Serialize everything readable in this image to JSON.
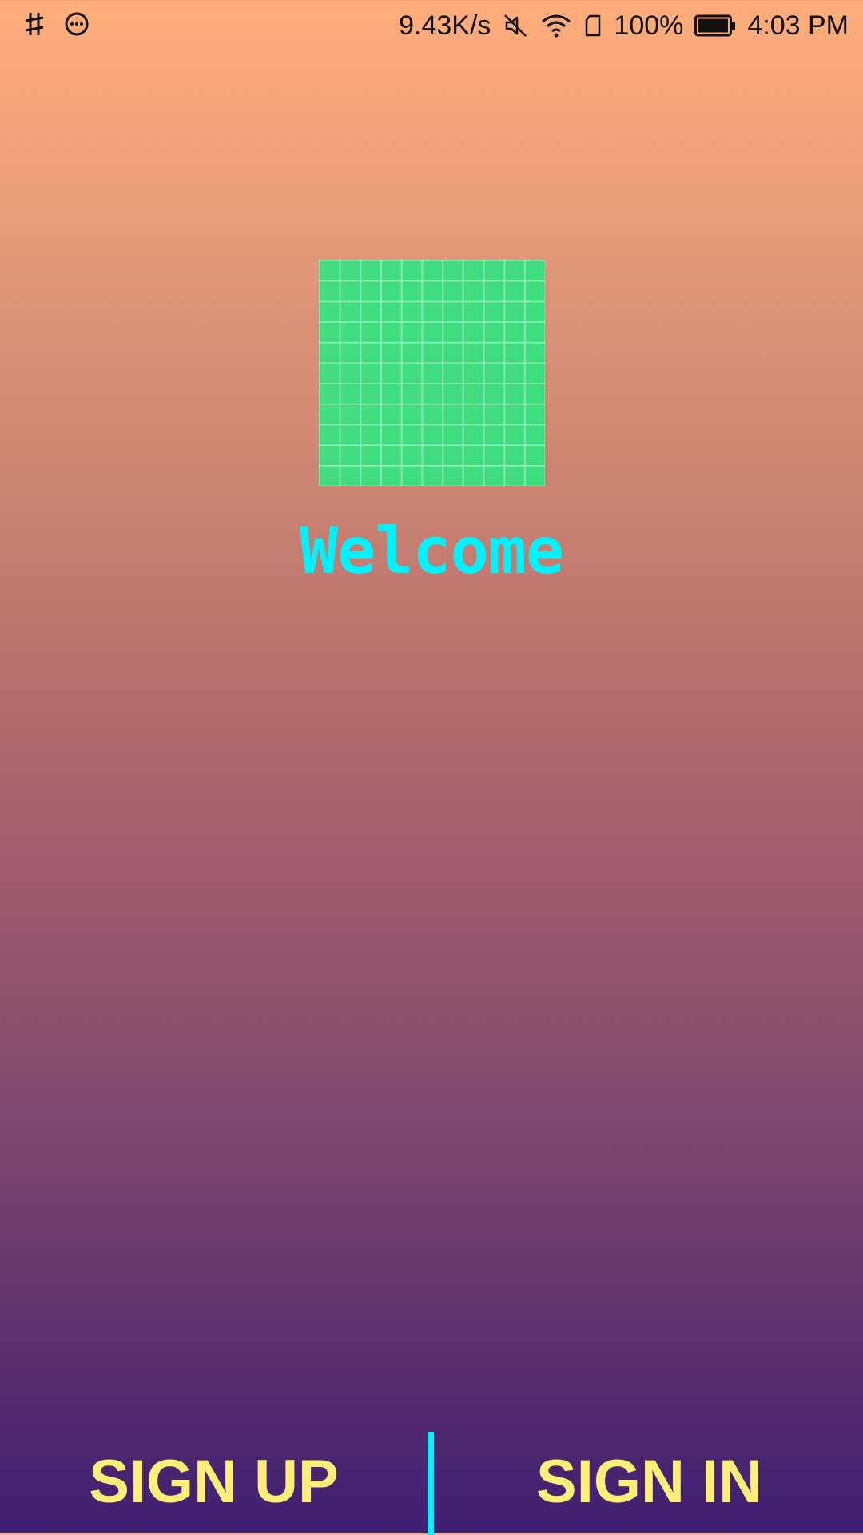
{
  "status_bar": {
    "left_icons": [
      "sync-off-icon",
      "chat-bubble-icon"
    ],
    "network_speed": "9.43K/s",
    "right_icons": [
      "mute-icon",
      "wifi-icon",
      "sim-icon"
    ],
    "battery_percent": "100%",
    "battery_icon": "battery-full-icon",
    "time": "4:03 PM"
  },
  "logo": {
    "icon": "grid-logo-icon",
    "color": "#3FDC80"
  },
  "welcome_text": "Welcome",
  "bottom_bar": {
    "signup_label": "SIGN UP",
    "signin_label": "SIGN IN"
  },
  "colors": {
    "welcome": "#00F2FF",
    "button_text": "#FFEE7A",
    "divider": "#00EEFF",
    "gradient_top": "#FFAD7A",
    "gradient_bottom": "#3E2070"
  }
}
